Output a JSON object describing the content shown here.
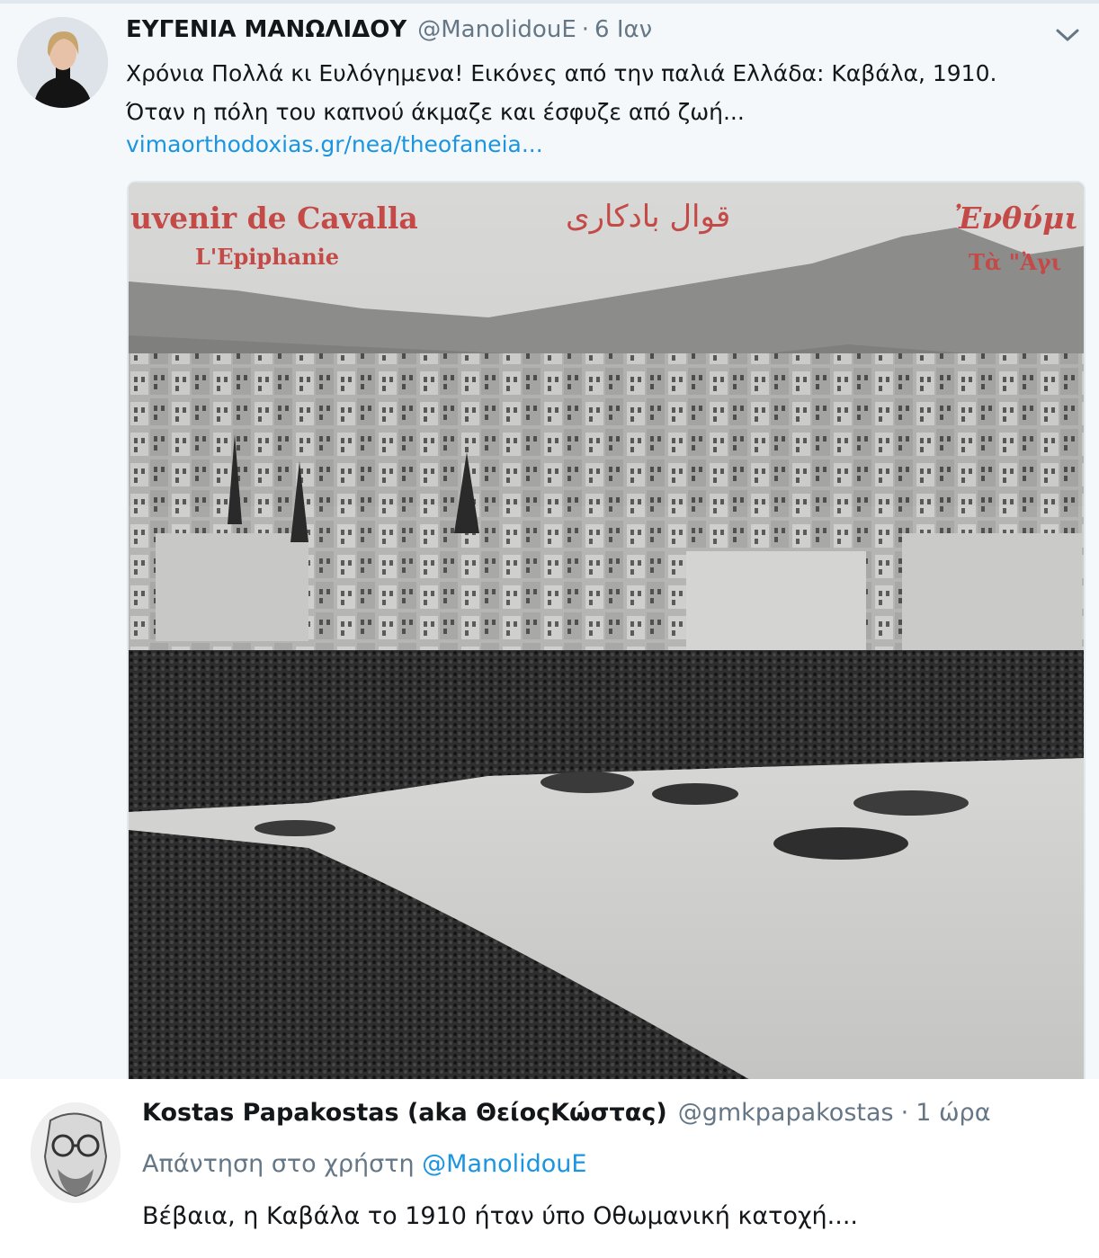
{
  "tweet": {
    "author_name": "ΕΥΓΕΝΙΑ ΜΑΝΩΛΙΔΟΥ",
    "author_handle": "@ManolidouE",
    "separator": "·",
    "timestamp": "6 Ιαν",
    "text_line1": "Χρόνια Πολλά κι Ευλόγημενα! Εικόνες από την παλιά Ελλάδα: Καβάλα, 1910.",
    "text_line2": "Όταν η πόλη του καπνού άκμαζε και έσφυζε από ζωή...",
    "link": "vimaorthodoxias.gr/nea/theofaneia...",
    "menu_icon": "chevron-down-icon",
    "photo": {
      "caption_title": "uvenir de Cavalla",
      "caption_sub": "L'Epiphanie",
      "caption_arabic": "قوال بادكارى",
      "caption_greek": "Ἐνθύμι",
      "caption_greek_sub": "Τὰ \"Ἀγι"
    }
  },
  "reply": {
    "author_name": "Kostas Papakostas (aka ΘείοςΚώστας)",
    "author_handle": "@gmkpapakostas",
    "separator": "·",
    "timestamp": "1 ώρα",
    "context_prefix": "Απάντηση στο χρήστη",
    "context_mention": "@ManolidouE",
    "text": "Βέβαια, η Καβάλα το 1910 ήταν ύπο Οθωμανική κατοχή...."
  },
  "colors": {
    "link_blue": "#1b95e0",
    "secondary_gray": "#657786",
    "postcard_red": "#c44a48",
    "tweet_bg": "#f5f8fa"
  }
}
